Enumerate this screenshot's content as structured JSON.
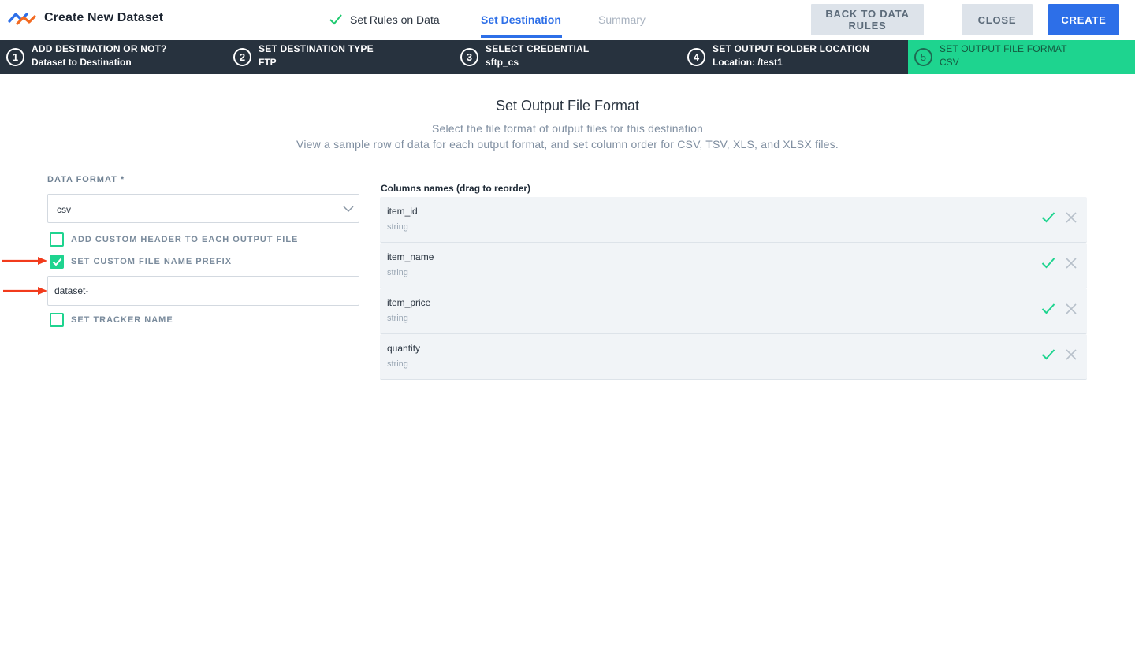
{
  "app": {
    "title": "Create New Dataset"
  },
  "wizard_tabs": [
    {
      "label": "Set Rules on Data",
      "state": "done"
    },
    {
      "label": "Set Destination",
      "state": "active"
    },
    {
      "label": "Summary",
      "state": "pending"
    }
  ],
  "actions": {
    "back_label": "BACK TO DATA RULES",
    "close_label": "CLOSE",
    "create_label": "CREATE"
  },
  "steps": [
    {
      "number": "1",
      "title": "ADD DESTINATION OR NOT?",
      "value": "Dataset to Destination"
    },
    {
      "number": "2",
      "title": "SET DESTINATION TYPE",
      "value": "FTP"
    },
    {
      "number": "3",
      "title": "SELECT CREDENTIAL",
      "value": "sftp_cs"
    },
    {
      "number": "4",
      "title": "SET OUTPUT FOLDER LOCATION",
      "value": "Location: /test1"
    },
    {
      "number": "5",
      "title": "SET OUTPUT FILE FORMAT",
      "value": "CSV"
    }
  ],
  "heading": {
    "title": "Set Output File Format",
    "subtitle1": "Select the file format of output files for this destination",
    "subtitle2": "View a sample row of data for each output format, and set column order for CSV, TSV, XLS, and XLSX files."
  },
  "form": {
    "data_format_label": "DATA FORMAT *",
    "data_format_value": "csv",
    "custom_header_label": "ADD CUSTOM HEADER TO EACH OUTPUT FILE",
    "custom_header_checked": false,
    "prefix_label": "SET CUSTOM FILE NAME PREFIX",
    "prefix_checked": true,
    "prefix_value": "dataset-",
    "tracker_label": "SET TRACKER NAME",
    "tracker_checked": false
  },
  "columns": {
    "label": "Columns names (drag to reorder)",
    "items": [
      {
        "name": "item_id",
        "type": "string"
      },
      {
        "name": "item_name",
        "type": "string"
      },
      {
        "name": "item_price",
        "type": "string"
      },
      {
        "name": "quantity",
        "type": "string"
      }
    ]
  },
  "colors": {
    "primary": "#2d6fe8",
    "accent_green": "#1ed48f",
    "steps_bar": "#27323e",
    "annotation_arrow": "#f23b1c"
  },
  "icons": {
    "logo": "brand-logo-icon",
    "done_check": "check-icon",
    "dropdown": "chevron-down-icon",
    "include": "check-icon",
    "remove": "close-icon",
    "annotation": "arrow-right-icon"
  }
}
